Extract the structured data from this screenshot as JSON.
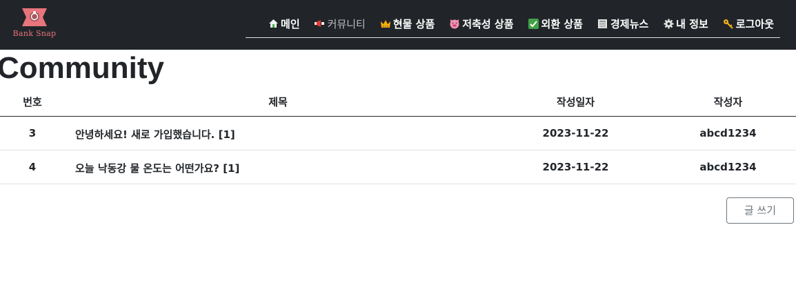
{
  "brand": {
    "logo_text": "Bank Snap",
    "color": "#e8747c"
  },
  "nav": {
    "items": [
      {
        "label": "메인",
        "icon": "house-icon",
        "glyph": "⌂",
        "icon_color": "#4caf50",
        "active": false
      },
      {
        "label": "커뮤니티",
        "icon": "megaphone-icon",
        "glyph": "📢",
        "icon_color": "#e53935",
        "active": true
      },
      {
        "label": "현물 상품",
        "icon": "crown-icon",
        "glyph": "♛",
        "icon_color": "#f5b300",
        "active": false
      },
      {
        "label": "저축성 상품",
        "icon": "pig-icon",
        "glyph": "🐷",
        "icon_color": "#f48fb1",
        "active": false
      },
      {
        "label": "외환 상품",
        "icon": "check-mark-icon",
        "glyph": "✔",
        "icon_color": "#ffffff",
        "active": false
      },
      {
        "label": "경제뉴스",
        "icon": "newspaper-icon",
        "glyph": "▤",
        "icon_color": "#d8d8d8",
        "active": false
      },
      {
        "label": "내 정보",
        "icon": "gear-icon",
        "glyph": "⚙",
        "icon_color": "#e0e0e0",
        "active": false
      },
      {
        "label": "로그아웃",
        "icon": "key-icon",
        "glyph": "🔑",
        "icon_color": "#f2b11b",
        "active": false
      }
    ]
  },
  "page": {
    "title": "Community"
  },
  "table": {
    "headers": {
      "num": "번호",
      "title": "제목",
      "date": "작성일자",
      "author": "작성자"
    },
    "rows": [
      {
        "num": "3",
        "title": "안녕하세요! 새로 가입했습니다. [1]",
        "date": "2023-11-22",
        "author": "abcd1234"
      },
      {
        "num": "4",
        "title": "오늘 낙동강 물 온도는 어떤가요? [1]",
        "date": "2023-11-22",
        "author": "abcd1234"
      }
    ]
  },
  "actions": {
    "write_label": "글 쓰기"
  }
}
